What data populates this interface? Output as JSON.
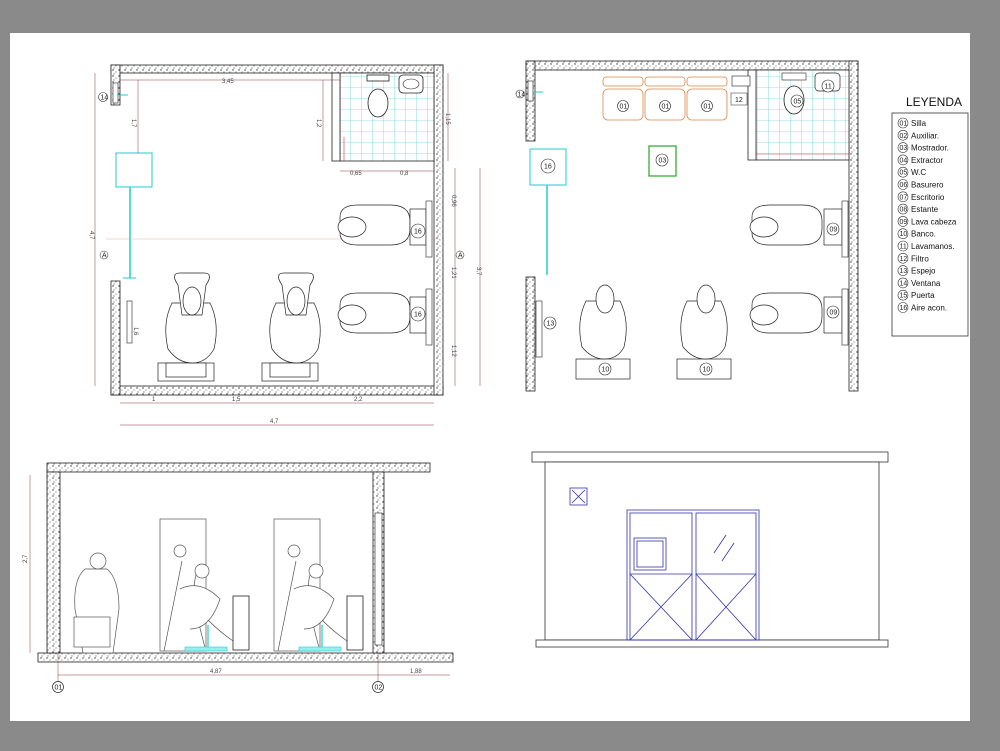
{
  "legend": {
    "title": "LEYENDA",
    "items": [
      {
        "num": "01",
        "label": "Silla"
      },
      {
        "num": "02",
        "label": "Auxiliar."
      },
      {
        "num": "03",
        "label": "Mostrador."
      },
      {
        "num": "04",
        "label": "Extractor"
      },
      {
        "num": "05",
        "label": "W.C"
      },
      {
        "num": "06",
        "label": "Basurero"
      },
      {
        "num": "07",
        "label": "Escritorio"
      },
      {
        "num": "08",
        "label": "Estante"
      },
      {
        "num": "09",
        "label": "Lava cabeza"
      },
      {
        "num": "10",
        "label": "Banco."
      },
      {
        "num": "11",
        "label": "Lavamanos."
      },
      {
        "num": "12",
        "label": "Filtro"
      },
      {
        "num": "13",
        "label": "Espejo"
      },
      {
        "num": "14",
        "label": "Ventana"
      },
      {
        "num": "15",
        "label": "Puerta"
      },
      {
        "num": "16",
        "label": "Aire acon."
      }
    ]
  },
  "plan_left": {
    "dims": {
      "top_width": "3,45",
      "wall_left_small": "1,7",
      "bath_height": "1,15",
      "bath_side": "1,2",
      "bath_w1": "0,65",
      "bath_w2": "0,8",
      "total_height": "4,7",
      "right_a": "0,96",
      "right_b": "1,21",
      "right_c": "1,12",
      "right_total": "3,7",
      "bottom_1": "1",
      "bottom_2": "1,5",
      "bottom_3": "2,2",
      "bottom_total": "4,7",
      "door_width": "1,6"
    },
    "marks": {
      "axis_a": "A",
      "axis_b": "A",
      "aire": "16",
      "window": "14"
    }
  },
  "plan_right": {
    "chairs": [
      "01",
      "01",
      "01"
    ],
    "marks": {
      "mostrador": "03",
      "filtro": "12",
      "wc": "05",
      "lavamanos": "11",
      "aire": "16",
      "espejo": "13",
      "lava1": "09",
      "lava2": "09",
      "sillon1": "10",
      "sillon2": "10",
      "window": "14"
    }
  },
  "section": {
    "dims": {
      "height": "2,7",
      "width": "4,87",
      "right": "1,88"
    },
    "axes": {
      "left": "01",
      "right": "02"
    }
  }
}
